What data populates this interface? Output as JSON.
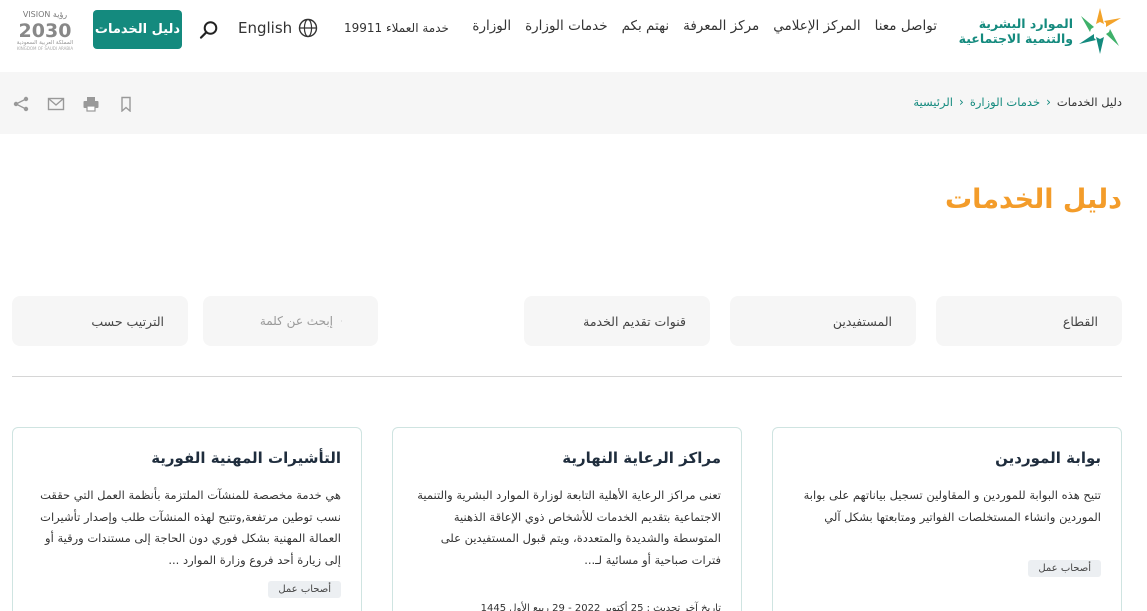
{
  "header": {
    "logo_line1": "الموارد البشرية",
    "logo_line2": "والتنمية الاجتماعية",
    "nav": [
      "الوزارة",
      "خدمات الوزارة",
      "نهتم بكم",
      "مركز المعرفة",
      "المركز الإعلامي",
      "تواصل معنا"
    ],
    "hotline": "خدمة العملاء 19911",
    "language": "English",
    "cta_label": "دليل الخدمات",
    "vision_top": "VISION رؤية",
    "vision_year": "2030",
    "vision_bottom": "المملكة العربية السعودية",
    "vision_bottom2": "KINGDOM OF SAUDI ARABIA"
  },
  "breadcrumb": {
    "items": [
      "الرئيسية",
      "خدمات الوزارة"
    ],
    "current": "دليل الخدمات"
  },
  "page_title": "دليل الخدمات",
  "filters": {
    "sector": "القطاع",
    "beneficiaries": "المستفيدين",
    "channels": "قنوات تقديم الخدمة",
    "search_placeholder": "إبحث عن كلمة",
    "sort": "الترتيب حسب"
  },
  "cards": [
    {
      "title": "بوابة الموردين",
      "description": "تتيح هذه البوابة للموردين و المقاولين تسجيل بياناتهم على بوابة الموردين وانشاء المستخلصات الفواتير ومتابعتها بشكل آلي",
      "tag": "أصحاب عمل"
    },
    {
      "title": "مراكز الرعاية النهارية",
      "description": "تعنى مراكز الرعاية الأهلية التابعة لوزارة الموارد البشرية والتنمية الاجتماعية بتقديم الخدمات للأشخاص ذوي الإعاقة الذهنية المتوسطة والشديدة والمتعددة، ويتم قبول المستفيدين على فترات صباحية أو مسائية لـ...",
      "date": "تاريخ آخر تحديث : 25 أكتوبر 2022 - 29 ربيع الأول 1445"
    },
    {
      "title": "التأشيرات المهنية الفورية",
      "description": "هي خدمة مخصصة للمنشآت الملتزمة بأنظمة العمل التي حققت نسب توطين مرتفعة,وتتيح لهذه المنشآت طلب وإصدار تأشيرات العمالة المهنية بشكل فوري دون الحاجة إلى مستندات ورقية أو إلى زيارة أحد فروع وزارة الموارد ...",
      "tag": "أصحاب عمل"
    }
  ],
  "colors": {
    "brand_teal": "#148a7e",
    "title_orange": "#f39c2a"
  },
  "icons": {
    "globe": "globe-icon",
    "search": "search-icon",
    "share": "share-icon",
    "mail": "mail-icon",
    "print": "print-icon",
    "bookmark": "bookmark-icon"
  }
}
